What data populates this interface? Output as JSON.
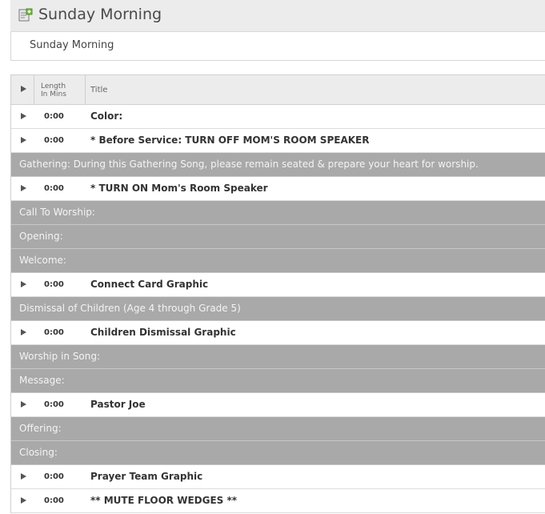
{
  "page": {
    "title": "Sunday Morning",
    "plan_name": "Sunday Morning",
    "header_icon": "plan-document-icon"
  },
  "table": {
    "columns": {
      "length_line1": "Length",
      "length_line2": "In Mins",
      "title": "Title"
    },
    "rows": [
      {
        "type": "item",
        "length": "0:00",
        "title": "Color:"
      },
      {
        "type": "item",
        "length": "0:00",
        "title": "* Before Service: TURN OFF MOM'S ROOM SPEAKER"
      },
      {
        "type": "header",
        "title": "Gathering: During this Gathering Song, please remain seated & prepare your heart for worship."
      },
      {
        "type": "item",
        "length": "0:00",
        "title": "* TURN ON Mom's Room Speaker"
      },
      {
        "type": "header",
        "title": "Call To Worship:"
      },
      {
        "type": "header",
        "title": "Opening:"
      },
      {
        "type": "header",
        "title": "Welcome:"
      },
      {
        "type": "item",
        "length": "0:00",
        "title": "Connect Card Graphic"
      },
      {
        "type": "header",
        "title": "Dismissal of Children (Age 4 through Grade 5)"
      },
      {
        "type": "item",
        "length": "0:00",
        "title": "Children Dismissal Graphic"
      },
      {
        "type": "header",
        "title": "Worship in Song:"
      },
      {
        "type": "header",
        "title": "Message:"
      },
      {
        "type": "item",
        "length": "0:00",
        "title": "Pastor Joe"
      },
      {
        "type": "header",
        "title": "Offering:"
      },
      {
        "type": "header",
        "title": "Closing:"
      },
      {
        "type": "item",
        "length": "0:00",
        "title": "Prayer Team Graphic"
      },
      {
        "type": "item",
        "length": "0:00",
        "title": "** MUTE FLOOR WEDGES **"
      }
    ]
  }
}
